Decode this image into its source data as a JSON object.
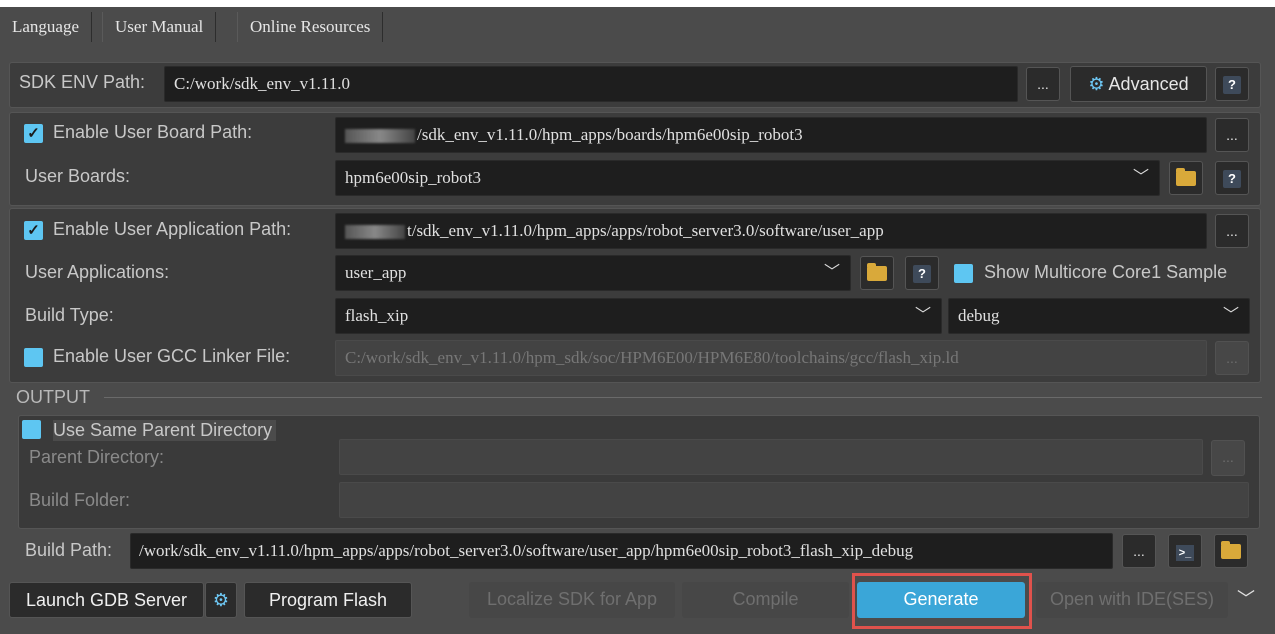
{
  "menu": [
    "Language",
    "User Manual",
    "Online Resources"
  ],
  "sdk": {
    "label": "SDK ENV Path:",
    "value": "C:/work/sdk_env_v1.11.0",
    "browse": "...",
    "advanced": "Advanced",
    "help": "?"
  },
  "board": {
    "enable_label": "Enable User Board Path:",
    "path": "/sdk_env_v1.11.0/hpm_apps/boards/hpm6e00sip_robot3",
    "browse": "...",
    "boards_label": "User Boards:",
    "boards_value": "hpm6e00sip_robot3",
    "help": "?"
  },
  "app": {
    "enable_label": "Enable User Application Path:",
    "path": "t/sdk_env_v1.11.0/hpm_apps/apps/robot_server3.0/software/user_app",
    "browse": "...",
    "apps_label": "User Applications:",
    "apps_value": "user_app",
    "help": "?",
    "multicore_label": "Show Multicore Core1 Sample",
    "build_type_label": "Build Type:",
    "build_type_value": "flash_xip",
    "build_mode_value": "debug",
    "linker_label": "Enable User GCC Linker File:",
    "linker_value": "C:/work/sdk_env_v1.11.0/hpm_sdk/soc/HPM6E00/HPM6E80/toolchains/gcc/flash_xip.ld",
    "linker_browse": "..."
  },
  "output": {
    "section_label": "OUTPUT",
    "same_parent_label": "Use Same Parent Directory",
    "parent_dir_label": "Parent Directory:",
    "parent_browse": "...",
    "build_folder_label": "Build Folder:",
    "build_path_label": "Build Path:",
    "build_path_value": "/work/sdk_env_v1.11.0/hpm_apps/apps/robot_server3.0/software/user_app/hpm6e00sip_robot3_flash_xip_debug",
    "build_path_browse": "..."
  },
  "actions": {
    "launch_gdb": "Launch GDB Server",
    "program_flash": "Program Flash",
    "localize_sdk": "Localize SDK for App",
    "compile": "Compile",
    "generate": "Generate",
    "open_ide": "Open with IDE(SES)"
  },
  "colors": {
    "accent": "#3aa6d8",
    "highlight_border": "#e0524c",
    "checkbox": "#5ec6f2",
    "folder": "#d9a93a"
  }
}
